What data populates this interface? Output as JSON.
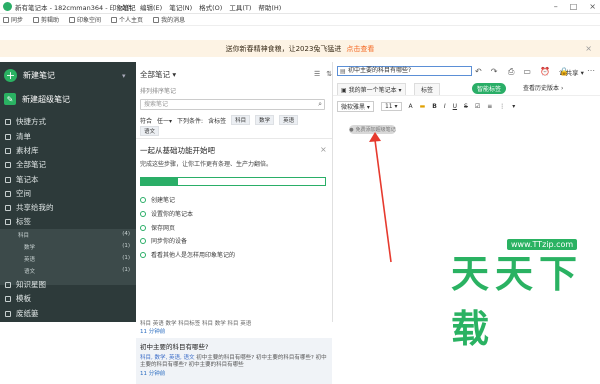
{
  "window": {
    "title": "新有笔记本 - 182cmman364 - 印象笔记",
    "menu": [
      "文件",
      "编辑(E)",
      "笔记(N)",
      "格式(O)",
      "工具(T)",
      "帮助(H)"
    ]
  },
  "toolbar": {
    "sync": "同步",
    "assistant": "剪辑助",
    "space": "印象空间",
    "profile": "个人主页",
    "messages": "我的消息"
  },
  "banner": {
    "text": "送你新春精神食粮，让2023兔飞猛进",
    "link": "点击查看"
  },
  "sidebar": {
    "new_note": "新建笔记",
    "new_super_note": "新建超级笔记",
    "items": [
      {
        "label": "快捷方式",
        "icon": "star-icon"
      },
      {
        "label": "清单",
        "icon": "checklist-icon"
      },
      {
        "label": "素材库",
        "icon": "library-icon"
      },
      {
        "label": "全部笔记",
        "icon": "notes-icon"
      },
      {
        "label": "笔记本",
        "icon": "notebook-icon"
      },
      {
        "label": "空间",
        "icon": "space-icon"
      },
      {
        "label": "共享给我的",
        "icon": "shared-icon"
      },
      {
        "label": "标签",
        "icon": "tag-icon"
      }
    ],
    "tags": [
      {
        "name": "科目",
        "count": "(4)"
      },
      {
        "name": "数学",
        "count": "(1)"
      },
      {
        "name": "英语",
        "count": "(1)"
      },
      {
        "name": "语文",
        "count": "(1)"
      }
    ],
    "bottom_items": [
      {
        "label": "知识星图",
        "icon": "map-icon"
      },
      {
        "label": "模板",
        "icon": "template-icon"
      },
      {
        "label": "废纸篓",
        "icon": "trash-icon"
      }
    ]
  },
  "note_list": {
    "header": "全部笔记",
    "subheader": "排列排序笔记",
    "search_placeholder": "搜索笔记",
    "filter_label": "符合",
    "filter_mode": "任一",
    "filter_tags_label": "下列条件:",
    "tags": [
      "含标签",
      "科目",
      "数学",
      "英语",
      "语文"
    ],
    "onboarding_title": "一起从基础功能开始吧",
    "onboarding_sub": "完成这些步骤，让你工作更有条理、生产力翻倍。",
    "progress": 0.2,
    "steps": [
      "创建笔记",
      "设置你的笔记本",
      "保存网页",
      "同步你的设备",
      "看看其他人是怎样用印象笔记的"
    ],
    "first_note_meta": "科目 英语 数学 科目标签 科目 数学 科目 英语",
    "first_note_time": "11 分钟前",
    "second_note_title": "初中主要的科目有哪些?",
    "second_note_tags": "科目, 数学, 英语, 语文",
    "second_note_body": "初中主要的科目有哪些? 初中主要的科目有哪些? 初中主要的科目有哪些? 初中主要的科目有哪些",
    "second_note_time": "11 分钟前"
  },
  "editor": {
    "title": "初中主要的科目有哪些?",
    "notebook": "我的第一个笔记本",
    "tag_button": "标签",
    "smart_tag": "智能标签",
    "share_label": "共享",
    "version_label": "查看历史版本",
    "font_name": "微软雅黑",
    "font_size": "11",
    "badge_text": "免费添加超级笔记"
  },
  "watermark": {
    "chars": "天天下载",
    "url": "www.TTzip.com"
  },
  "colors": {
    "sidebar_bg": "#2d3a3a",
    "accent": "#2aae67",
    "banner_bg": "#fdf3e4",
    "link_orange": "#f46a25"
  }
}
